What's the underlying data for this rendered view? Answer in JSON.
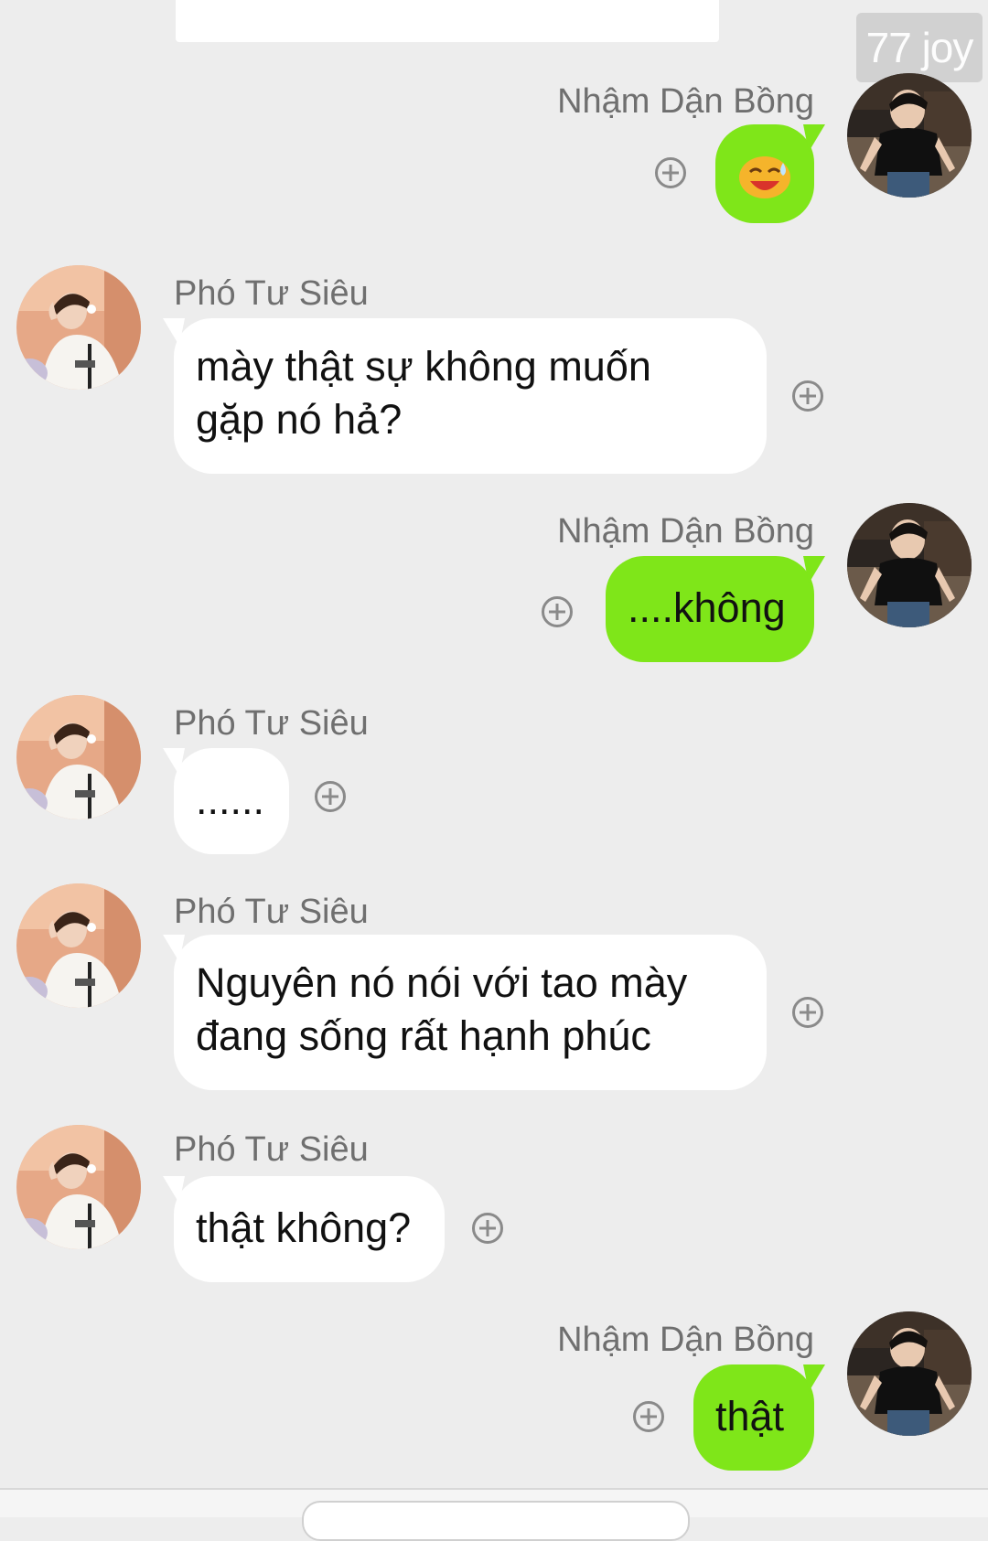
{
  "watermark": "77 joy",
  "participants": {
    "other": "Phó Tư Siêu",
    "me": "Nhậm Dận Bồng"
  },
  "messages": [
    {
      "sender": "Nhậm Dận Bồng",
      "direction": "out",
      "type": "emoji",
      "icon": "grinning-sweat-emoji"
    },
    {
      "sender": "Phó Tư Siêu",
      "direction": "in",
      "type": "text",
      "lines": [
        "mày thật sự không muốn",
        "gặp nó hả?"
      ]
    },
    {
      "sender": "Nhậm Dận Bồng",
      "direction": "out",
      "type": "text",
      "lines": [
        "....không"
      ]
    },
    {
      "sender": "Phó Tư Siêu",
      "direction": "in",
      "type": "text",
      "lines": [
        "......"
      ]
    },
    {
      "sender": "Phó Tư Siêu",
      "direction": "in",
      "type": "text",
      "lines": [
        "Nguyên nó nói với tao mày",
        "đang sống rất hạnh phúc"
      ]
    },
    {
      "sender": "Phó Tư Siêu",
      "direction": "in",
      "type": "text",
      "lines": [
        "thật không?"
      ]
    },
    {
      "sender": "Nhậm Dận Bồng",
      "direction": "out",
      "type": "text",
      "lines": [
        "thật"
      ]
    }
  ],
  "icons": {
    "react": "plus-circle-icon"
  },
  "colors": {
    "background": "#ededed",
    "outgoing_bubble": "#7fe619",
    "incoming_bubble": "#ffffff",
    "name_text": "#6f6f6f",
    "react_icon": "#8a8a8a"
  }
}
